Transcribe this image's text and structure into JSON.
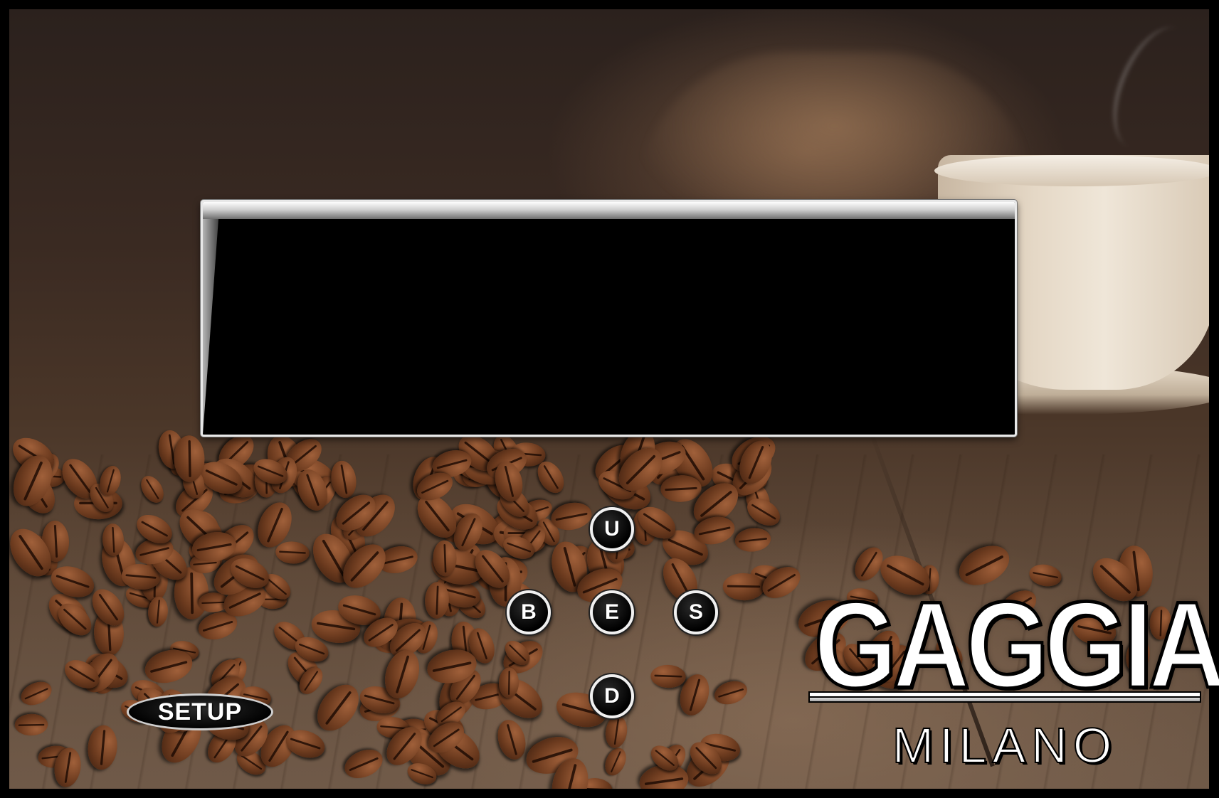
{
  "display": {
    "text": ""
  },
  "controls": {
    "up_label": "U",
    "back_label": "B",
    "enter_label": "E",
    "select_label": "S",
    "down_label": "D",
    "setup_label": "SETUP"
  },
  "logo": {
    "brand": "GAGGIA",
    "subtitle": "MILANO"
  },
  "colors": {
    "display_background": "#000000",
    "button_background": "#000000",
    "button_border": "#f0f0f0"
  }
}
